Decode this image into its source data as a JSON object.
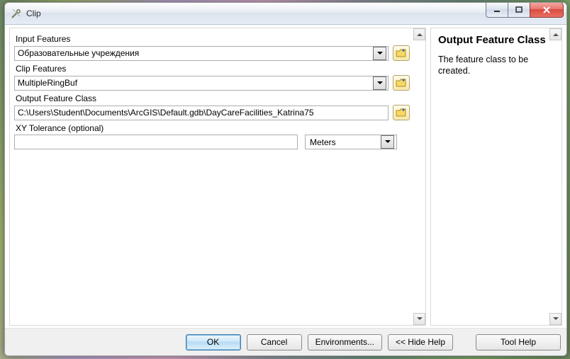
{
  "window": {
    "title": "Clip"
  },
  "form": {
    "input_features": {
      "label": "Input Features",
      "value": "Образовательные учреждения"
    },
    "clip_features": {
      "label": "Clip Features",
      "value": "MultipleRingBuf"
    },
    "output_fc": {
      "label": "Output Feature Class",
      "value": "C:\\Users\\Student\\Documents\\ArcGIS\\Default.gdb\\DayCareFacilities_Katrina75"
    },
    "xy_tolerance": {
      "label": "XY Tolerance (optional)",
      "value": "",
      "unit": "Meters"
    }
  },
  "help": {
    "title": "Output Feature Class",
    "body": "The feature class to be created."
  },
  "buttons": {
    "ok": "OK",
    "cancel": "Cancel",
    "env": "Environments...",
    "hide_help": "<< Hide Help",
    "tool_help": "Tool Help"
  }
}
